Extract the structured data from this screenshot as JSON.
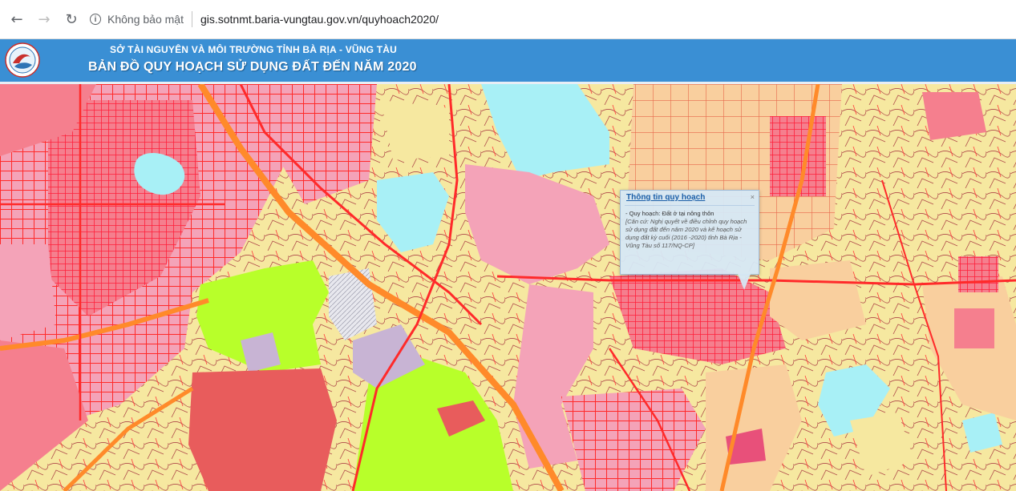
{
  "browser": {
    "back_icon": "arrow-left-icon",
    "forward_icon": "arrow-right-icon",
    "reload_icon": "reload-icon",
    "security_label": "Không bảo mật",
    "url": "gis.sotnmt.baria-vungtau.gov.vn/quyhoach2020/"
  },
  "header": {
    "agency": "SỞ TÀI NGUYÊN VÀ MÔI TRƯỜNG TỈNH BÀ RỊA - VŨNG TÀU",
    "title": "BẢN ĐỒ QUY HOẠCH SỬ DỤNG ĐẤT ĐẾN NĂM 2020",
    "background_color": "#3a8fd4"
  },
  "map": {
    "colors": {
      "residential": "#f4a3b8",
      "urban": "#f57f8e",
      "roads": "#ff2a2a",
      "highway": "#ff8a2a",
      "forest": "#b8ff2a",
      "water": "#a8f0f6",
      "rural_land": "#f6e8a0",
      "agriculture": "#f9cf9e",
      "public": "#e8507a",
      "protected": "#c8b4d4",
      "industrial": "#e85c5c"
    }
  },
  "popup": {
    "title": "Thông tin quy hoạch",
    "close_label": "×",
    "line1": "- Quy hoạch: Đất ở tại nông thôn",
    "citation": "[Căn cứ: Nghị quyết về điều chỉnh quy hoạch sử dụng đất đến năm 2020 và kế hoạch sử dụng đất kỳ cuối (2016 -2020) tỉnh Bà Rịa - Vũng Tàu số 117/NQ-CP]"
  }
}
